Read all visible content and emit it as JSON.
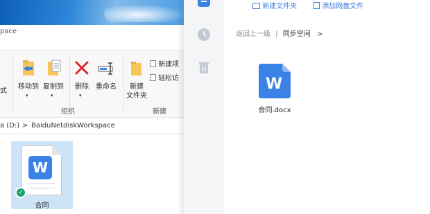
{
  "explorer": {
    "title_fragment": "pace",
    "ribbon": {
      "left_fragment": "式",
      "move_to": "移动到",
      "copy_to": "复制到",
      "delete": "删除",
      "rename": "重命名",
      "new_folder_line1": "新建",
      "new_folder_line2": "文件夹",
      "new_item": "新建项",
      "easy_access": "轻松访",
      "group_organize": "组织",
      "group_new": "新建"
    },
    "address": {
      "drive": "a (D:)",
      "sep": ">",
      "folder": "BaiduNetdiskWorkspace"
    },
    "file": {
      "name": "合同",
      "badge": "W"
    }
  },
  "panel": {
    "toolbar": {
      "new_folder": "新建文件夹",
      "add_file": "添加网盘文件"
    },
    "breadcrumb": {
      "back": "返回上一级",
      "sep": "|",
      "current": "同步空间",
      "arrow": ">"
    },
    "file": {
      "name": "合同.docx",
      "badge": "W"
    }
  },
  "colors": {
    "accent": "#3b82e6",
    "check": "#18a06c",
    "selection": "#cde3f7"
  }
}
